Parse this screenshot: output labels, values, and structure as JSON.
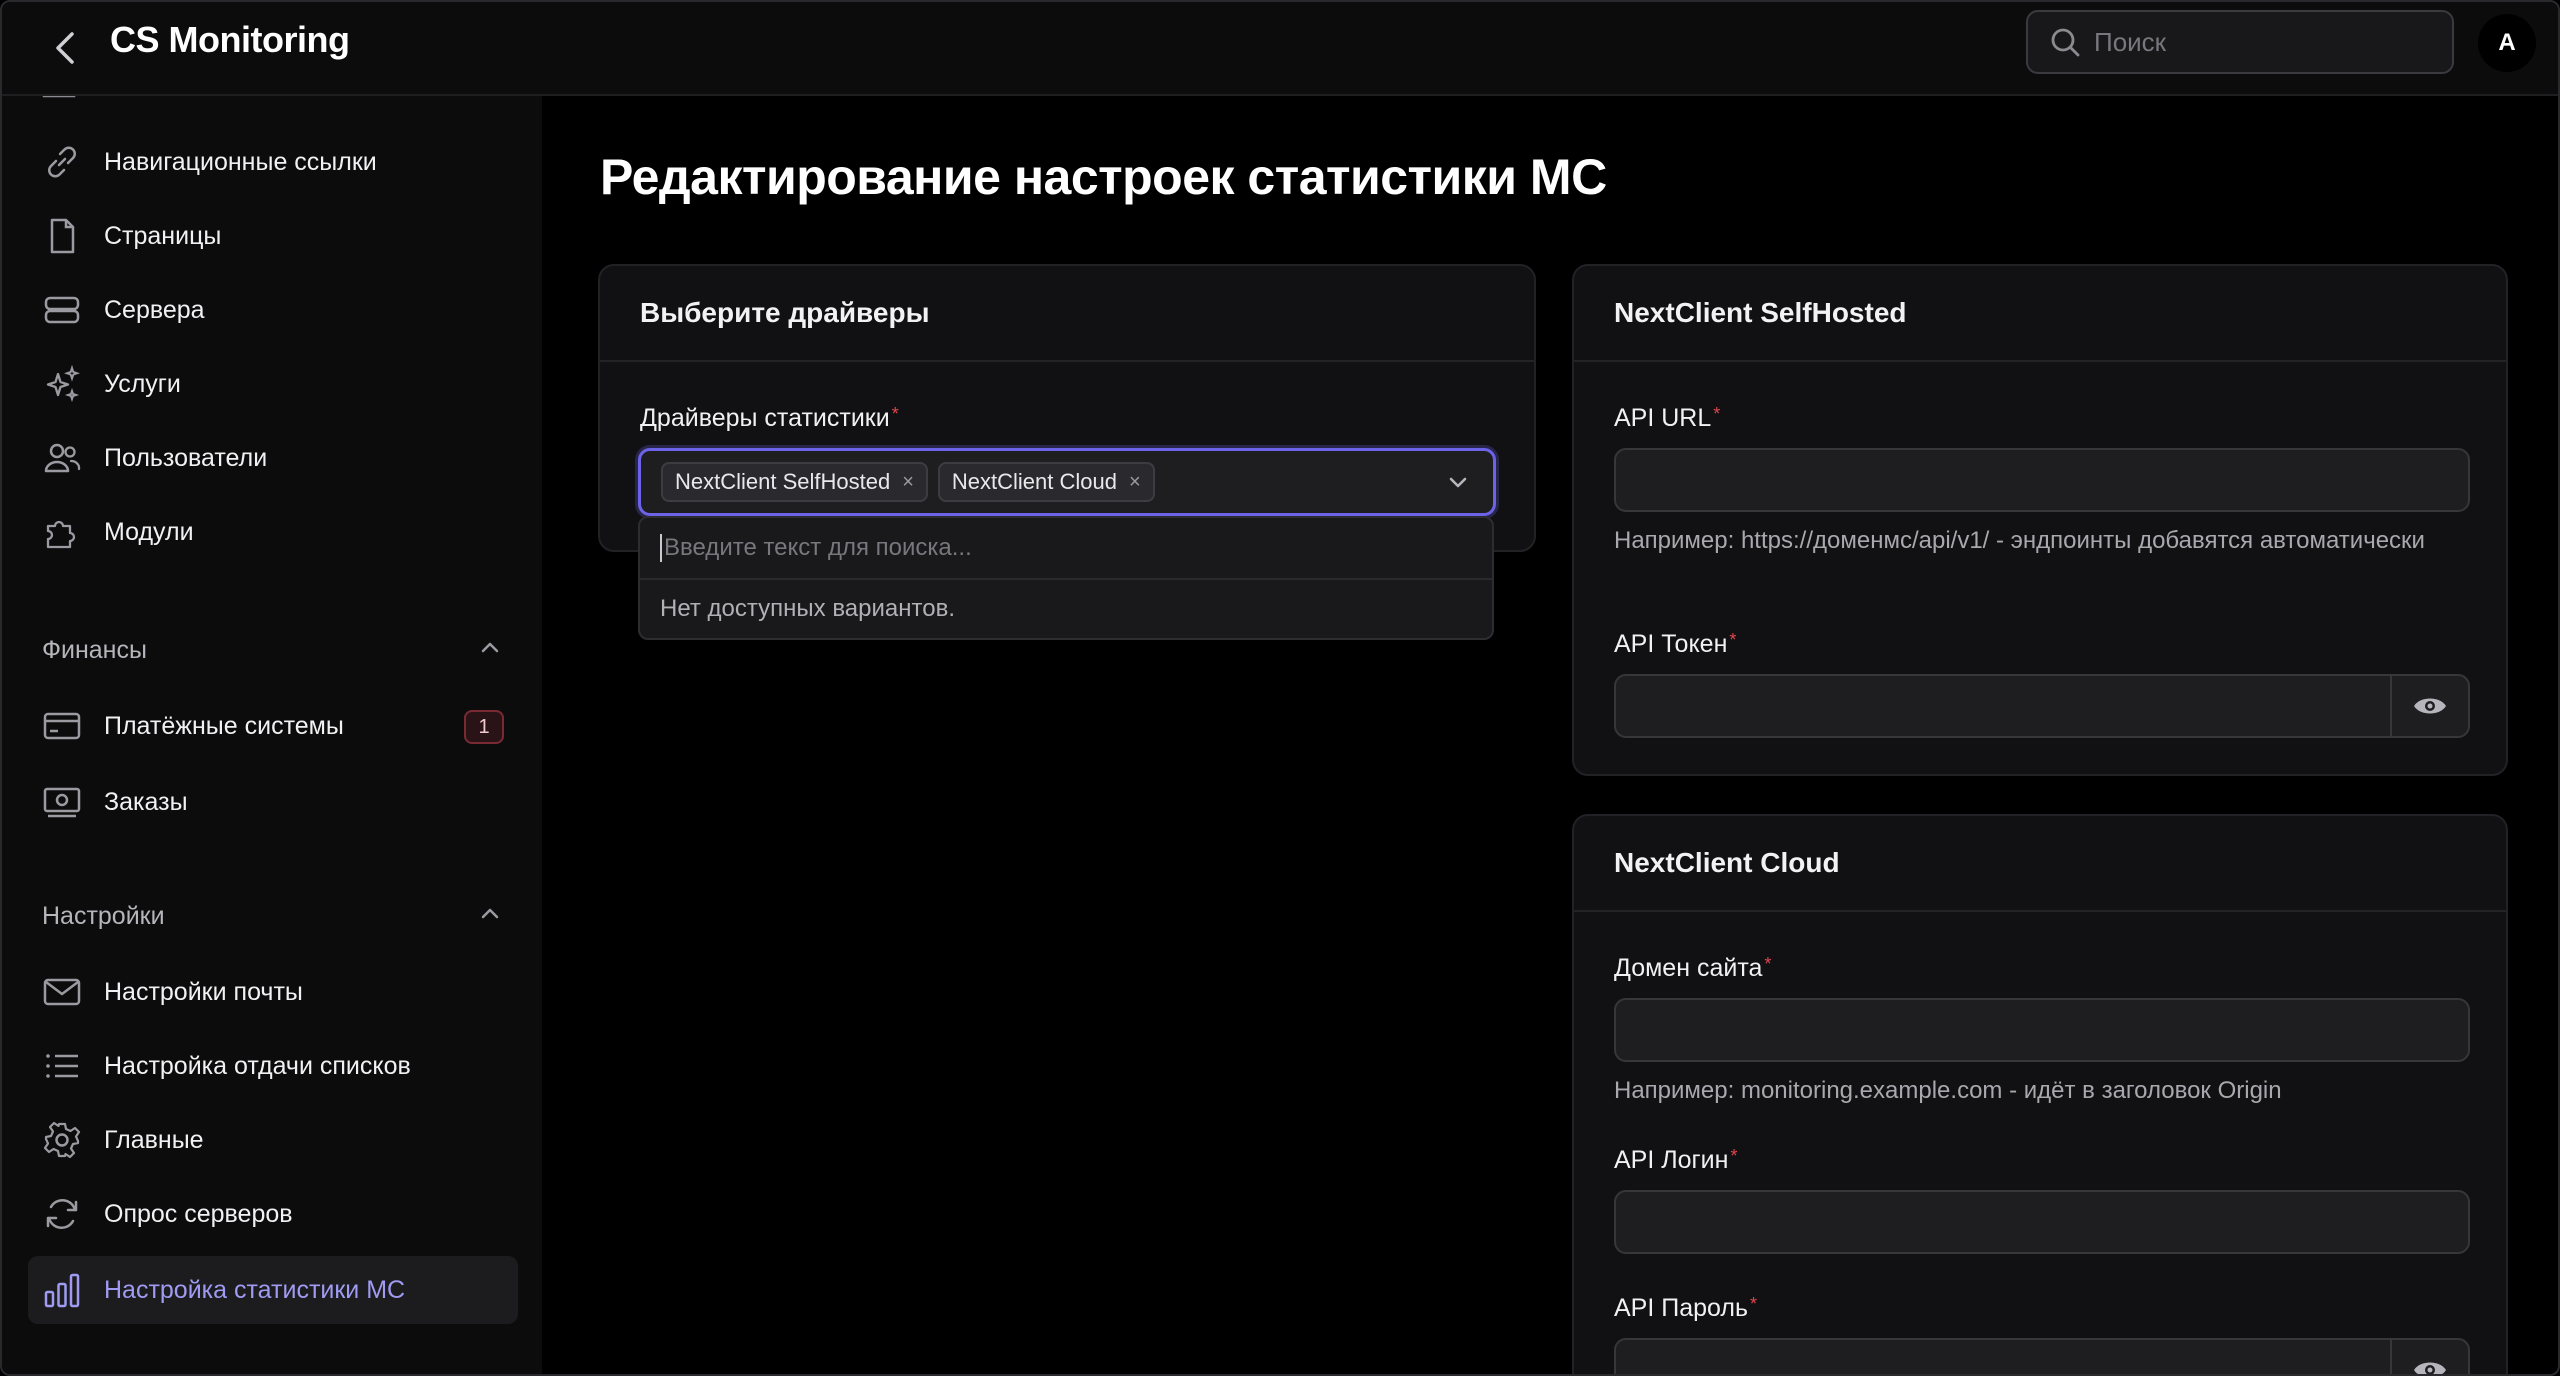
{
  "header": {
    "title": "CS Monitoring",
    "search_placeholder": "Поиск",
    "avatar_initial": "A"
  },
  "sidebar": {
    "items": [
      {
        "label": "Навигационные ссылки",
        "icon": "link-icon"
      },
      {
        "label": "Страницы",
        "icon": "file-icon"
      },
      {
        "label": "Сервера",
        "icon": "server-icon"
      },
      {
        "label": "Услуги",
        "icon": "sparkles-icon"
      },
      {
        "label": "Пользователи",
        "icon": "users-icon"
      },
      {
        "label": "Модули",
        "icon": "puzzle-icon"
      }
    ],
    "finance": {
      "title": "Финансы",
      "items": [
        {
          "label": "Платёжные системы",
          "icon": "credit-card-icon",
          "badge": "1"
        },
        {
          "label": "Заказы",
          "icon": "cash-icon"
        }
      ]
    },
    "settings": {
      "title": "Настройки",
      "items": [
        {
          "label": "Настройки почты",
          "icon": "mail-icon"
        },
        {
          "label": "Настройка отдачи списков",
          "icon": "list-icon"
        },
        {
          "label": "Главные",
          "icon": "gear-icon"
        },
        {
          "label": "Опрос серверов",
          "icon": "refresh-icon"
        },
        {
          "label": "Настройка статистики MC",
          "icon": "bar-chart-icon",
          "active": true
        }
      ]
    }
  },
  "main": {
    "title": "Редактирование настроек статистики MC",
    "drivers_card": {
      "title": "Выберите драйверы",
      "field_label": "Драйверы статистики",
      "selected": [
        "NextClient SelfHosted",
        "NextClient Cloud"
      ],
      "dropdown_search_placeholder": "Введите текст для поиска...",
      "dropdown_empty": "Нет доступных вариантов."
    },
    "selfhosted_card": {
      "title": "NextClient SelfHosted",
      "api_url_label": "API URL",
      "api_url_hint": "Например: https://доменмс/api/v1/ - эндпоинты добавятся автоматически",
      "api_token_label": "API Токен"
    },
    "cloud_card": {
      "title": "NextClient Cloud",
      "domain_label": "Домен сайта",
      "domain_hint": "Например: monitoring.example.com - идёт в заголовок Origin",
      "login_label": "API Логин",
      "password_label": "API Пароль"
    }
  },
  "colors": {
    "accent": "#6d63e8",
    "active_text": "#9f9bf2",
    "required": "#e2464f"
  }
}
